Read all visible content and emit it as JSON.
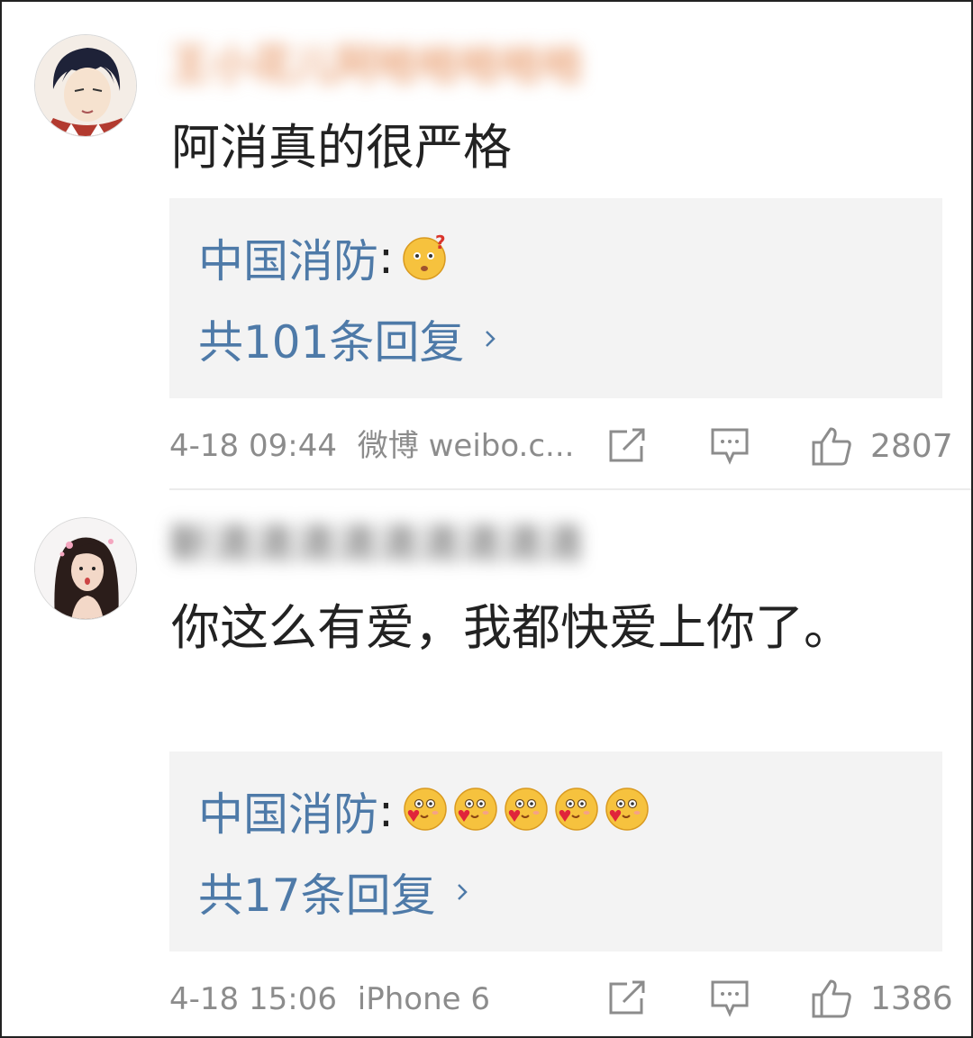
{
  "comments": [
    {
      "username": "王小花儿阿哈哈哈哈哈",
      "text": "阿消真的很严格",
      "reply": {
        "author": "中国消防",
        "colon": ":",
        "emoji": [
          "confused-emoji"
        ],
        "count_label": "共101条回复"
      },
      "time": "4-18 09:44",
      "source": "微博 weibo.c...",
      "likes": "2807"
    },
    {
      "username": "靳清清清清清清清清清",
      "text": "你这么有爱，我都快爱上你了。",
      "reply": {
        "author": "中国消防",
        "colon": ":",
        "emoji": [
          "love-emoji",
          "love-emoji",
          "love-emoji",
          "love-emoji",
          "love-emoji"
        ],
        "count_label": "共17条回复"
      },
      "time": "4-18 15:06",
      "source": "iPhone 6",
      "likes": "1386"
    }
  ],
  "icons": {
    "share": "share-icon",
    "reply": "comment-icon",
    "like": "thumbs-up-icon",
    "chevron": "chevron-right-icon"
  },
  "colors": {
    "link": "#4e7aa8",
    "meta": "#8c8c8c",
    "reply_bg": "#f3f3f3"
  }
}
